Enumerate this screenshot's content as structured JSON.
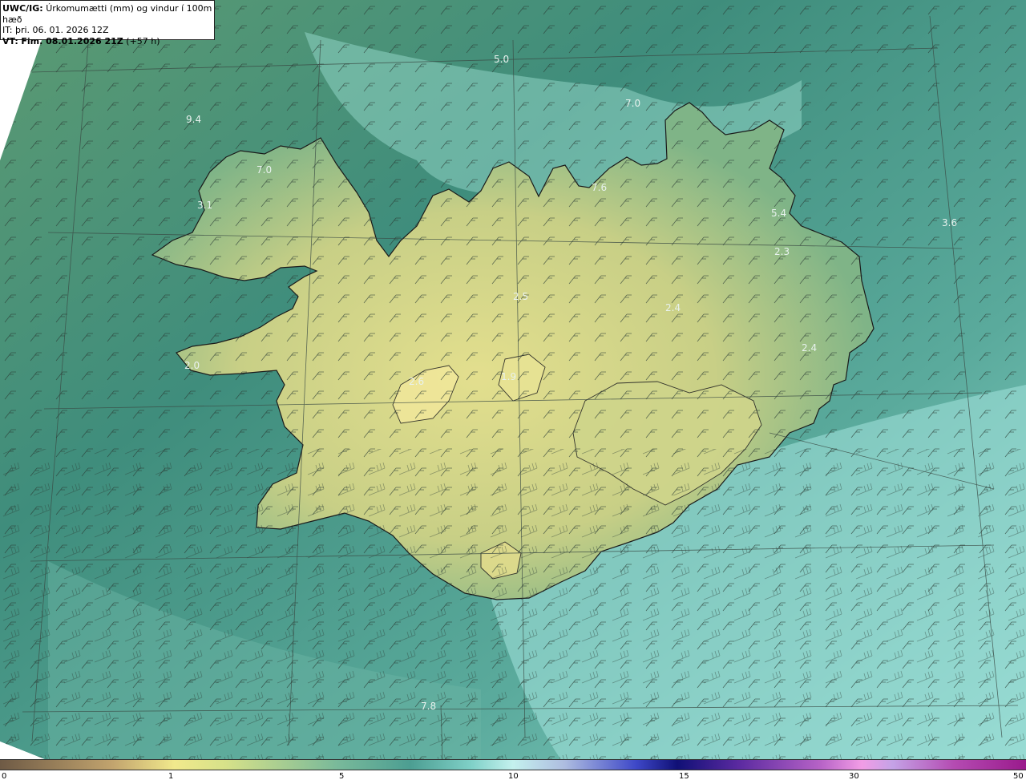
{
  "header": {
    "model": "UWC/IG:",
    "title": "Úrkomumætti (mm) og vindur í 100m hæð",
    "init_time": "IT: þri. 06. 01. 2026 12Z",
    "valid_prefix": "VT:",
    "valid_time": "Fim. 08.01.2026 21Z",
    "lead": "(+57 h)"
  },
  "map_labels": [
    "5.0",
    "7.0",
    "9.4",
    "7.0",
    "3.1",
    "7.6",
    "5.4",
    "3.6",
    "2.3",
    "2.4",
    "2.4",
    "2.5",
    "7.8",
    "2.6",
    "1.9",
    "2.0"
  ],
  "colorbar": {
    "ticks": [
      "0",
      "1",
      "5",
      "10",
      "15",
      "30",
      "50"
    ]
  },
  "colors": {
    "sea_teal": "#3e8f80",
    "land_yellow": "#d9d98a",
    "light_cyan": "#9fe0d8",
    "coast": "#1a1a1a"
  }
}
